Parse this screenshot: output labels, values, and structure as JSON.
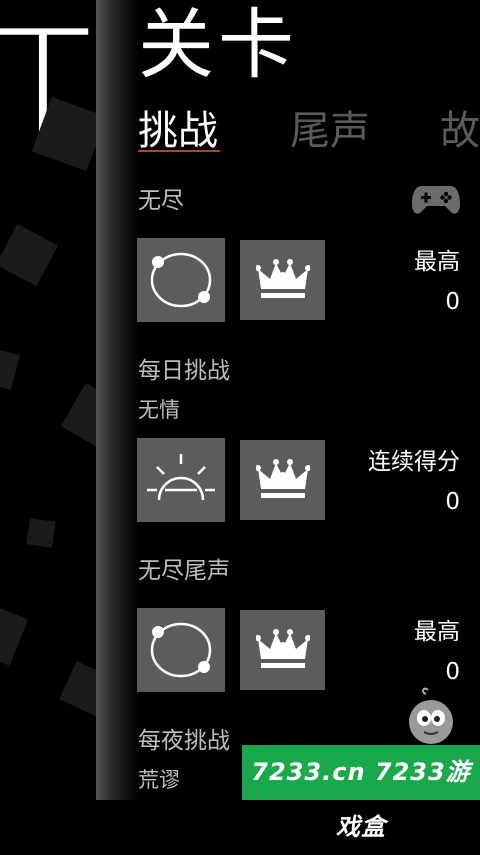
{
  "header": {
    "title": "关卡"
  },
  "background": {
    "glyph": "T"
  },
  "tabs": [
    {
      "label": "挑战",
      "active": true
    },
    {
      "label": "尾声",
      "active": false
    },
    {
      "label": "故",
      "active": false
    }
  ],
  "sections": [
    {
      "label": "无尽",
      "sublabel": "",
      "stat_label": "最高",
      "stat_value": "0",
      "icon": "orbit-icon"
    },
    {
      "label": "每日挑战",
      "sublabel": "无情",
      "stat_label": "连续得分",
      "stat_value": "0",
      "icon": "sunrise-icon"
    },
    {
      "label": "无尽尾声",
      "sublabel": "",
      "stat_label": "最高",
      "stat_value": "0",
      "icon": "orbit-icon"
    },
    {
      "label": "每夜挑战",
      "sublabel": "荒谬"
    }
  ],
  "watermark": {
    "text": "7233.cn 7233游戏盒"
  },
  "colors": {
    "tile": "#5c5c5c",
    "tab_inactive": "#5a5a5a",
    "tab_underline": "#c0392b",
    "banner": "#1aa94a"
  }
}
